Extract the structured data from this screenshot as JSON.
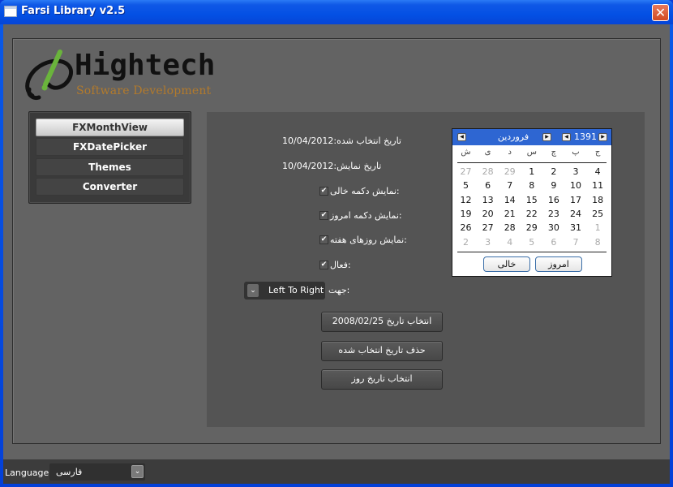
{
  "window": {
    "title": "Farsi Library v2.5",
    "close_icon": "close-x"
  },
  "logo": {
    "name": "Hightech",
    "tagline": "Software Development",
    "brand_green": "#6ab43c",
    "tagline_color": "#b27a2c"
  },
  "nav": {
    "items": [
      {
        "label": "FXMonthView",
        "active": true
      },
      {
        "label": "FXDatePicker",
        "active": false
      },
      {
        "label": "Themes",
        "active": false
      },
      {
        "label": "Converter",
        "active": false
      }
    ]
  },
  "form": {
    "selected_date_label": "10/04/2012:تاریخ انتخاب شده",
    "display_date_label": "10/04/2012:تاریخ نمایش",
    "show_empty_button_label": "نمایش دکمه خالی:",
    "show_empty_button_checked": true,
    "show_today_button_label": "نمایش دکمه امروز:",
    "show_today_button_checked": true,
    "show_weekdays_label": "نمایش روزهای هفته:",
    "show_weekdays_checked": true,
    "enabled_label": "فعال:",
    "enabled_checked": true,
    "direction_label": "جهت:",
    "direction_value": "Left To Right",
    "buttons": {
      "select_date": "2008/02/25 انتخاب تاریخ",
      "clear_selected": "حذف تاریخ انتخاب شده",
      "select_today": "انتخاب تاریخ روز"
    }
  },
  "calendar": {
    "month": "فروردین",
    "year": "1391",
    "header_color": "#2e66d2",
    "weekdays": [
      "ش",
      "ی",
      "د",
      "س",
      "چ",
      "پ",
      "ج"
    ],
    "weeks": [
      [
        {
          "d": "27",
          "o": true
        },
        {
          "d": "28",
          "o": true
        },
        {
          "d": "29",
          "o": true
        },
        {
          "d": "1"
        },
        {
          "d": "2"
        },
        {
          "d": "3"
        },
        {
          "d": "4"
        }
      ],
      [
        {
          "d": "5"
        },
        {
          "d": "6"
        },
        {
          "d": "7"
        },
        {
          "d": "8"
        },
        {
          "d": "9"
        },
        {
          "d": "10"
        },
        {
          "d": "11"
        }
      ],
      [
        {
          "d": "12"
        },
        {
          "d": "13"
        },
        {
          "d": "14"
        },
        {
          "d": "15"
        },
        {
          "d": "16"
        },
        {
          "d": "17"
        },
        {
          "d": "18"
        }
      ],
      [
        {
          "d": "19"
        },
        {
          "d": "20"
        },
        {
          "d": "21"
        },
        {
          "d": "22"
        },
        {
          "d": "23"
        },
        {
          "d": "24"
        },
        {
          "d": "25"
        }
      ],
      [
        {
          "d": "26"
        },
        {
          "d": "27"
        },
        {
          "d": "28"
        },
        {
          "d": "29"
        },
        {
          "d": "30"
        },
        {
          "d": "31"
        },
        {
          "d": "1",
          "o": true
        }
      ],
      [
        {
          "d": "2",
          "o": true
        },
        {
          "d": "3",
          "o": true
        },
        {
          "d": "4",
          "o": true
        },
        {
          "d": "5",
          "o": true
        },
        {
          "d": "6",
          "o": true
        },
        {
          "d": "7",
          "o": true
        },
        {
          "d": "8",
          "o": true
        }
      ]
    ],
    "empty_button": "خالی",
    "today_button": "امروز"
  },
  "footer": {
    "language_label": "Language:",
    "language_value": "فارسی"
  }
}
